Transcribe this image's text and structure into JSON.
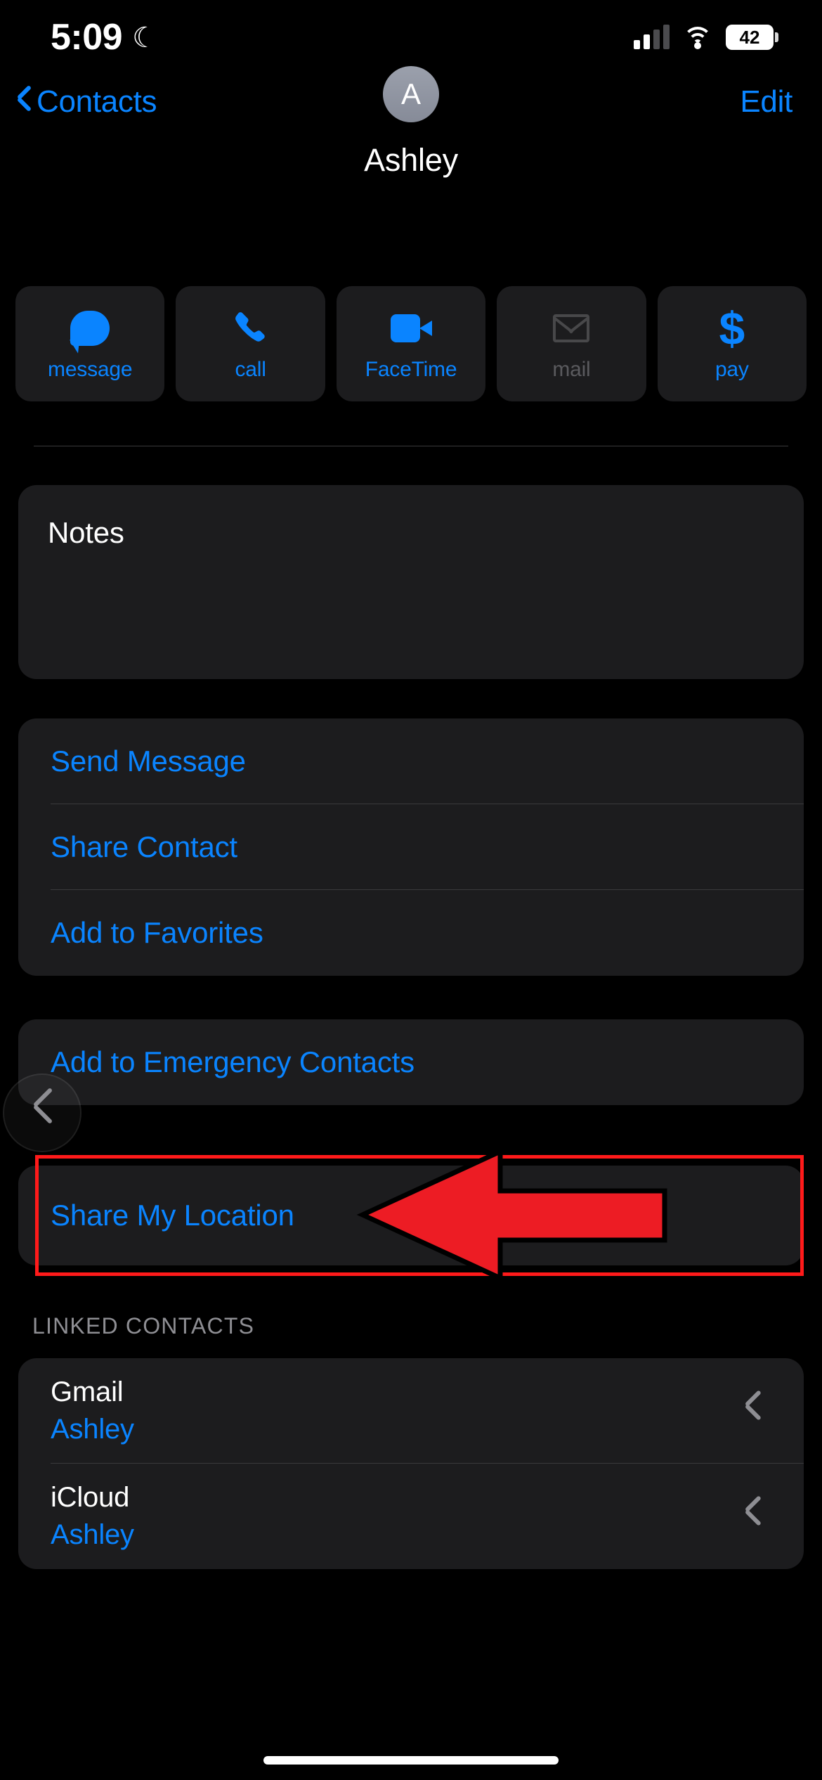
{
  "status_bar": {
    "time": "5:09",
    "dnd_icon": "crescent-moon-icon",
    "signal_icon": "cellular-signal-icon",
    "wifi_icon": "wifi-icon",
    "battery_level": "42"
  },
  "nav": {
    "back_label": "Contacts",
    "back_icon": "chevron-left-icon",
    "edit_label": "Edit"
  },
  "header": {
    "avatar_initial": "A",
    "contact_name": "Ashley"
  },
  "quick_actions": [
    {
      "label": "message",
      "icon": "message-bubble-icon",
      "disabled": false
    },
    {
      "label": "call",
      "icon": "phone-icon",
      "disabled": false
    },
    {
      "label": "FaceTime",
      "icon": "video-camera-icon",
      "disabled": false
    },
    {
      "label": "mail",
      "icon": "envelope-icon",
      "disabled": true
    },
    {
      "label": "pay",
      "icon": "dollar-sign-icon",
      "disabled": false
    }
  ],
  "notes": {
    "label": "Notes",
    "value": ""
  },
  "action_list": [
    {
      "label": "Send Message"
    },
    {
      "label": "Share Contact"
    },
    {
      "label": "Add to Favorites"
    }
  ],
  "emergency_row": {
    "label": "Add to Emergency Contacts"
  },
  "location_row": {
    "label": "Share My Location"
  },
  "swipe_back": {
    "icon": "chevron-right-circle-icon"
  },
  "linked_contacts": {
    "header": "LINKED CONTACTS",
    "rows": [
      {
        "title": "Gmail",
        "subtitle": "Ashley",
        "chevron": "chevron-right-icon"
      },
      {
        "title": "iCloud",
        "subtitle": "Ashley",
        "chevron": "chevron-right-icon"
      }
    ]
  },
  "annotation": {
    "highlight_color": "#ff1a1a",
    "arrow_color": "#ed1c24",
    "arrow_outline": "#000000",
    "target": "Share My Location"
  },
  "colors": {
    "accent_blue": "#0a84ff",
    "card_bg": "#1c1c1e",
    "page_bg": "#000000",
    "secondary_text": "#8e8e93",
    "disabled_text": "#5a5a5e"
  },
  "home_indicator": "home-indicator-bar"
}
